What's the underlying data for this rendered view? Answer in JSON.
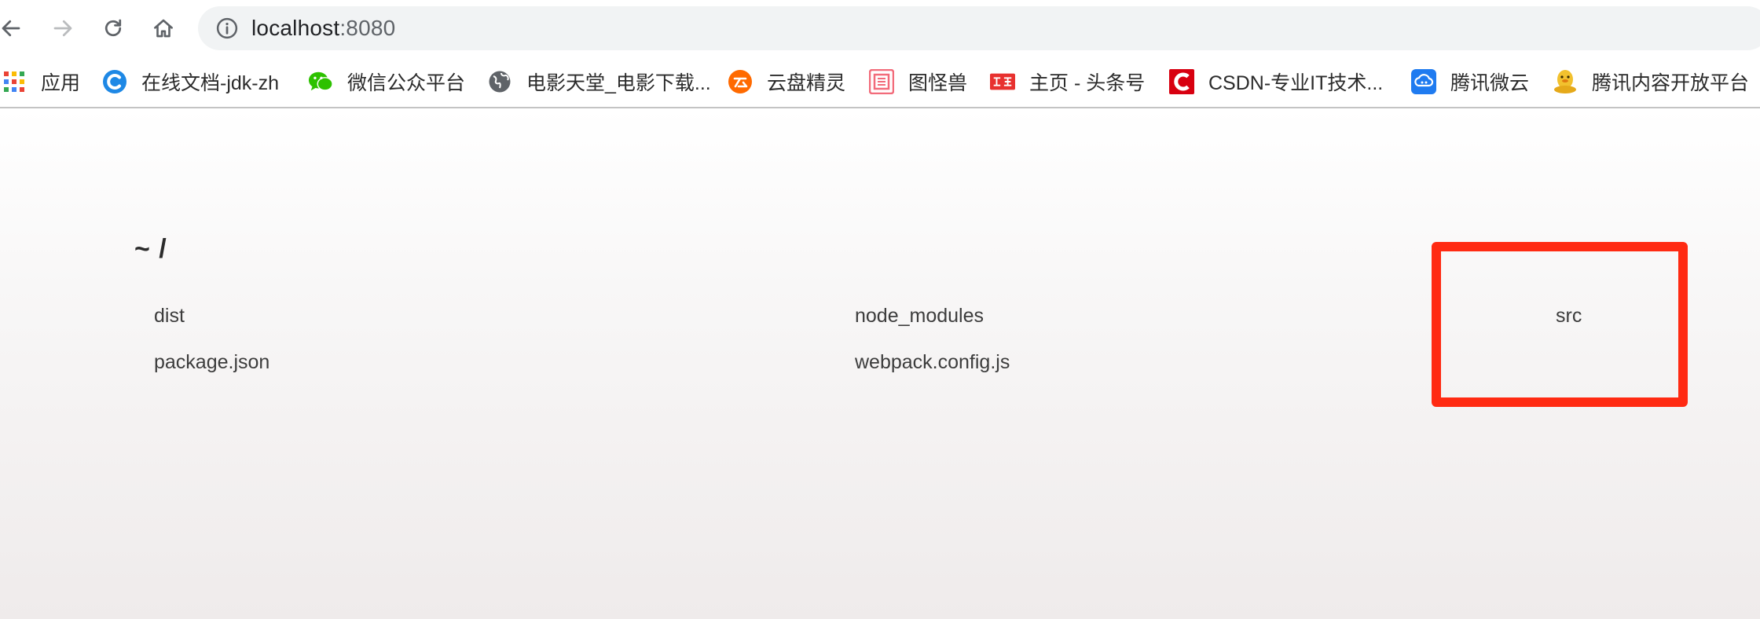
{
  "browser": {
    "url_host": "localhost",
    "url_port": ":8080"
  },
  "bookmarks": [
    {
      "label": "应用",
      "icon": "apps-grid-icon"
    },
    {
      "label": "在线文档-jdk-zh",
      "icon": "blue-c-logo-icon"
    },
    {
      "label": "微信公众平台",
      "icon": "wechat-icon"
    },
    {
      "label": "电影天堂_电影下载...",
      "icon": "globe-icon"
    },
    {
      "label": "云盘精灵",
      "icon": "cloud-disk-icon"
    },
    {
      "label": "图怪兽",
      "icon": "tuguaishou-icon"
    },
    {
      "label": "主页 - 头条号",
      "icon": "toutiao-icon"
    },
    {
      "label": "CSDN-专业IT技术...",
      "icon": "csdn-icon"
    },
    {
      "label": "腾讯微云",
      "icon": "weiyun-icon"
    },
    {
      "label": "腾讯内容开放平台",
      "icon": "qq-penguin-icon"
    }
  ],
  "listing": {
    "path": "~ /",
    "entries": [
      {
        "name": "dist"
      },
      {
        "name": "node_modules"
      },
      {
        "name": "src"
      },
      {
        "name": "package.json"
      },
      {
        "name": "webpack.config.js"
      }
    ]
  },
  "highlight_color": "#ff2a12"
}
